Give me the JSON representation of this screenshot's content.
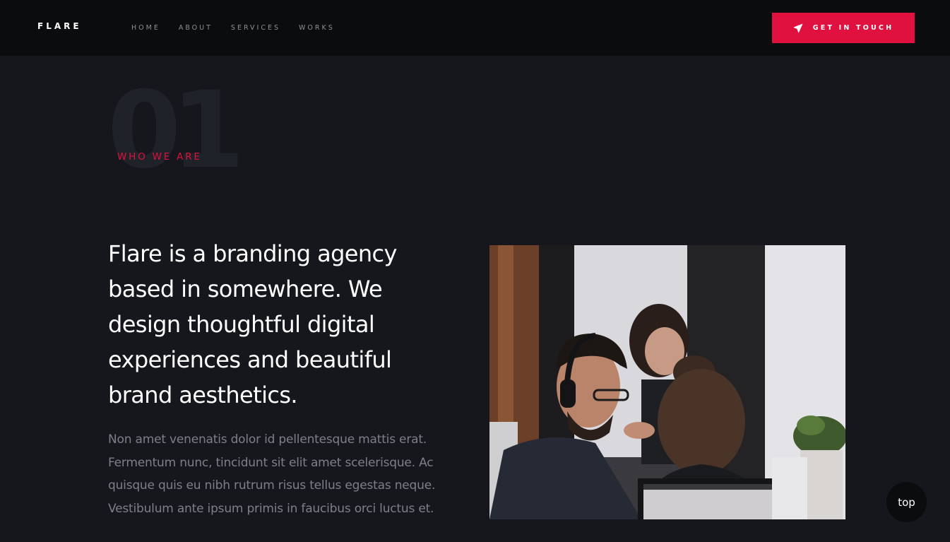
{
  "header": {
    "logo": "FLARE",
    "nav": [
      {
        "label": "HOME"
      },
      {
        "label": "ABOUT"
      },
      {
        "label": "SERVICES"
      },
      {
        "label": "WORKS"
      }
    ],
    "cta_label": "GET IN TOUCH",
    "cta_icon": "paper-plane-icon"
  },
  "section": {
    "number": "01",
    "kicker": "WHO WE ARE",
    "headline": "Flare is a branding agency based in somewhere. We design thoughtful digital experiences and beautiful brand aesthetics.",
    "body": "Non amet venenatis dolor id pellentesque mattis erat. Fermentum nunc, tincidunt sit elit amet scelerisque. Ac quisque quis eu nibh rutrum risus tellus egestas neque. Vestibulum ante ipsum primis in faucibus orci luctus et."
  },
  "scroll_top_label": "top",
  "colors": {
    "accent": "#e0113f",
    "background": "#15171c",
    "header_bg": "#0b0c0e"
  }
}
